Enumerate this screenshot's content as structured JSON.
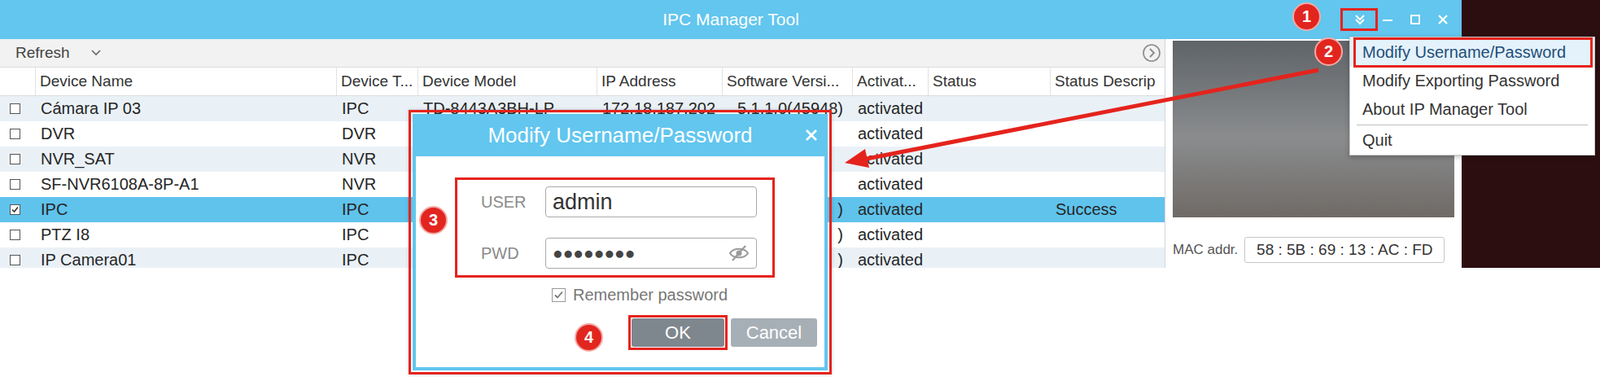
{
  "window": {
    "title": "IPC Manager Tool"
  },
  "toolbar": {
    "refresh": "Refresh"
  },
  "table": {
    "columns": [
      "Device Name",
      "Device T...",
      "Device Model",
      "IP Address",
      "Software Versi...",
      "Activat...",
      "Status",
      "Status Descrip"
    ],
    "rows": [
      {
        "checked": false,
        "selected": false,
        "cells": [
          "Cámara IP 03",
          "IPC",
          "TD-8443A3BH-LP",
          "172.18.187.202",
          "5.1.1.0(45948)",
          "activated",
          "",
          ""
        ]
      },
      {
        "checked": false,
        "selected": false,
        "cells": [
          "DVR",
          "DVR",
          "",
          "",
          "",
          "activated",
          "",
          ""
        ]
      },
      {
        "checked": false,
        "selected": false,
        "cells": [
          "NVR_SAT",
          "NVR",
          "",
          "",
          "",
          "activated",
          "",
          ""
        ]
      },
      {
        "checked": false,
        "selected": false,
        "cells": [
          "SF-NVR6108A-8P-A1",
          "NVR",
          "",
          "",
          "",
          "activated",
          "",
          ""
        ]
      },
      {
        "checked": true,
        "selected": true,
        "cells": [
          "IPC",
          "IPC",
          "",
          "",
          ")",
          "activated",
          "",
          "Success"
        ]
      },
      {
        "checked": false,
        "selected": false,
        "cells": [
          "PTZ I8",
          "IPC",
          "",
          "",
          ")",
          "activated",
          "",
          ""
        ]
      },
      {
        "checked": false,
        "selected": false,
        "cells": [
          "IP Camera01",
          "IPC",
          "",
          "",
          ")",
          "activated",
          "",
          ""
        ]
      }
    ]
  },
  "preview": {
    "mac_label": "MAC addr.",
    "mac": "58 : 5B : 69 : 13 : AC : FD"
  },
  "menu": {
    "items": [
      {
        "label": "Modify Username/Password",
        "selected": true,
        "divider": false
      },
      {
        "label": "Modify Exporting Password",
        "selected": false,
        "divider": false
      },
      {
        "label": "About IP Manager Tool",
        "selected": false,
        "divider": false
      },
      {
        "label": "Quit",
        "selected": false,
        "divider": true
      }
    ]
  },
  "dialog": {
    "title": "Modify Username/Password",
    "fields": [
      {
        "label": "USER",
        "value": "admin",
        "kind": "text"
      },
      {
        "label": "PWD",
        "value": "●●●●●●●●",
        "kind": "password"
      }
    ],
    "remember": {
      "label": "Remember password",
      "checked": true
    },
    "buttons": [
      {
        "label": "OK",
        "selected": true
      },
      {
        "label": "Cancel",
        "selected": false
      }
    ]
  },
  "badges": [
    {
      "label": "1"
    },
    {
      "label": "2"
    },
    {
      "label": "3"
    },
    {
      "label": "4"
    }
  ]
}
